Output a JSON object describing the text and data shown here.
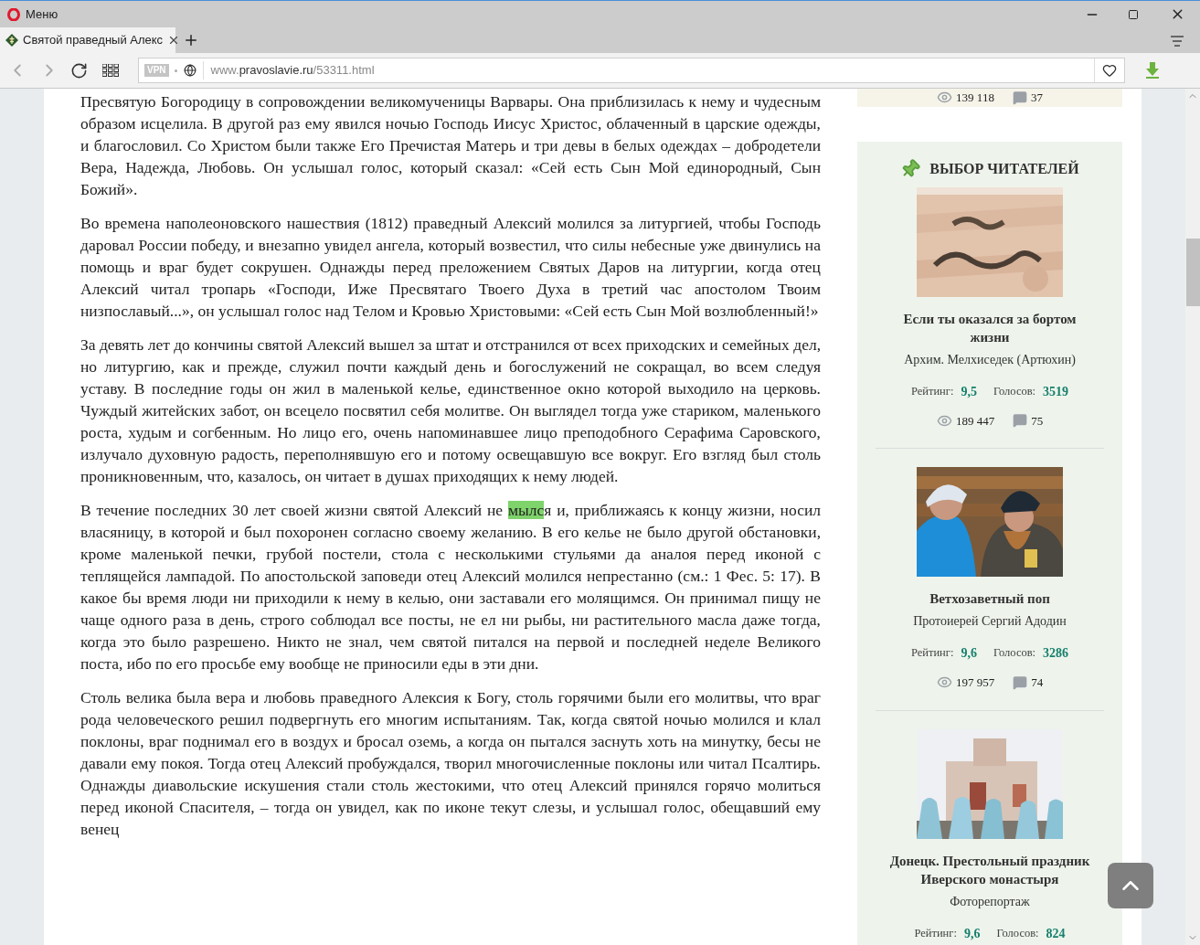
{
  "browser": {
    "menu_label": "Меню",
    "tab": {
      "title": "Святой праведный Алекс",
      "selected": true
    },
    "vpn_badge": "VPN",
    "address": {
      "prefix": "www.",
      "domain": "pravoslavie.ru",
      "path": "/53311.html"
    }
  },
  "article": {
    "paragraphs": [
      {
        "parts": [
          {
            "text": "Пресвятую Богородицу в сопровождении великомученицы Варвары. Она приблизилась к нему и чудесным образом исцелила. В другой раз ему явился ночью Господь Иисус Христос, облаченный в царские одежды, и благословил. Со Христом были также Его Пречистая Матерь и три девы в белых одеждах – добродетели Вера, Надежда, Любовь. Он услышал голос, который сказал: «Сей есть Сын Мой единородный, Сын Божий».",
            "highlighted": false
          }
        ]
      },
      {
        "parts": [
          {
            "text": "Во времена наполеоновского нашествия (1812) праведный Алексий молился за литургией, чтобы Господь даровал России победу, и внезапно увидел ангела, который возвестил, что силы небесные уже двинулись на помощь и враг будет сокрушен. Однажды перед преложением Святых Даров на литургии, когда отец Алексий читал тропарь «Господи, Иже Пресвятаго Твоего Духа в третий час апостолом Твоим низпославый...», он услышал голос над Телом и Кровью Христовыми: «Сей есть Сын Мой возлюбленный!»",
            "highlighted": false
          }
        ]
      },
      {
        "parts": [
          {
            "text": "За девять лет до кончины святой Алексий вышел за штат и отстранился от всех приходских и семейных дел, но литургию, как и прежде, служил почти каждый день и богослужений не сокращал, во всем следуя уставу. В последние годы он жил в маленькой келье, единственное окно которой выходило на церковь. Чуждый житейских забот, он всецело посвятил себя молитве. Он выглядел тогда уже стариком, маленького роста, худым и согбенным. Но лицо его, очень напоминавшее лицо преподобного Серафима Саровского, излучало духовную радость, переполнявшую его и потому освещавшую все вокруг. Его взгляд был столь проникновенным, что, казалось, он читает в душах приходящих к нему людей.",
            "highlighted": false
          }
        ]
      },
      {
        "parts": [
          {
            "text": "В течение последних 30 лет своей жизни святой Алексий не ",
            "highlighted": false
          },
          {
            "text": "мылс",
            "highlighted": true
          },
          {
            "text": "я и, приближаясь к концу жизни, носил власяницу, в которой и был похоронен согласно своему желанию. В его келье не было другой обстановки, кроме маленькой печки, грубой постели, стола с несколькими стульями да аналоя перед иконой с теплящейся лампадой. По апостольской заповеди отец Алексий молился непрестанно (см.: 1 Фес. 5: 17). В какое бы время люди ни приходили к нему в келью, они заставали его молящимся. Он принимал пищу не чаще одного раза в день, строго соблюдал все посты, не ел ни рыбы, ни растительного масла даже тогда, когда это было разрешено. Никто не знал, чем святой питался на первой и последней неделе Великого поста, ибо по его просьбе ему вообще не приносили еды в эти дни.",
            "highlighted": false
          }
        ]
      },
      {
        "parts": [
          {
            "text": "Столь велика была вера и любовь праведного Алексия к Богу, столь горячими были его молитвы, что враг рода человеческого решил подвергнуть его многим испытаниям. Так, когда святой ночью молился и клал поклоны, враг поднимал его в воздух и бросал оземь, а когда он пытался заснуть хоть на минутку, бесы не давали ему покоя. Тогда отец Алексий пробуждался, творил многочисленные поклоны или читал Псалтирь. Однажды диавольские искушения стали столь жестокими, что отец Алексий принялся горячо молиться перед иконой Спасителя, – тогда он увидел, как по иконе текут слезы, и услышал голос, обещавший ему венец",
            "highlighted": false
          }
        ]
      }
    ]
  },
  "sidebar": {
    "previous_card": {
      "views": "139 118",
      "comments": "37"
    },
    "readers_choice": {
      "title": "ВЫБОР ЧИТАТЕЛЕЙ",
      "items": [
        {
          "title": "Если ты оказался за бортом жизни",
          "author": "Архим. Мелхиседек (Артюхин)",
          "rating_label": "Рейтинг:",
          "rating": "9,5",
          "votes_label": "Голосов:",
          "votes": "3519",
          "views": "189 447",
          "comments": "75"
        },
        {
          "title": "Ветхозаветный поп",
          "author": "Протоиерей Сергий Адодин",
          "rating_label": "Рейтинг:",
          "rating": "9,6",
          "votes_label": "Голосов:",
          "votes": "3286",
          "views": "197 957",
          "comments": "74"
        },
        {
          "title": "Донецк. Престольный праздник Иверского монастыря",
          "author": "Фоторепортаж",
          "rating_label": "Рейтинг:",
          "rating": "9,6",
          "votes_label": "Голосов:",
          "votes": "824"
        }
      ]
    }
  }
}
